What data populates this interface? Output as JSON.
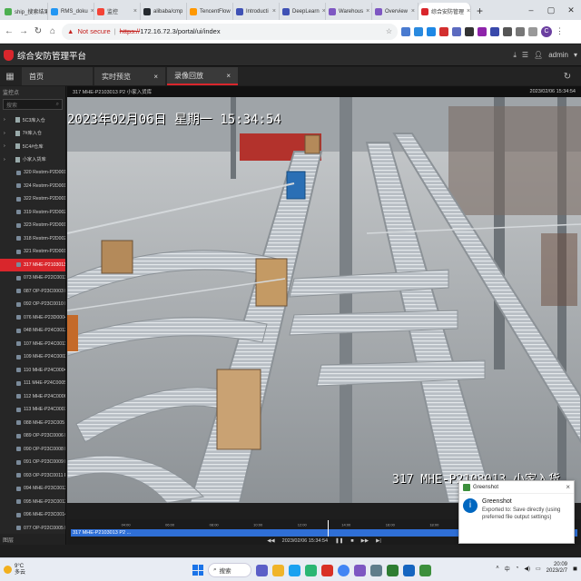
{
  "browser": {
    "tabs": [
      {
        "label": "ship_搜索结果",
        "color": "#4caf50"
      },
      {
        "label": "RMS_doku",
        "color": "#2196f3"
      },
      {
        "label": "监控",
        "color": "#f44336"
      },
      {
        "label": "alibaba/cmp",
        "color": "#24292e"
      },
      {
        "label": "TencentFlow",
        "color": "#ff9800"
      },
      {
        "label": "Introducti",
        "color": "#3f51b5"
      },
      {
        "label": "DeepLearn",
        "color": "#3f51b5"
      },
      {
        "label": "Warehous",
        "color": "#7e57c2"
      },
      {
        "label": "Overview",
        "color": "#7e57c2"
      },
      {
        "label": "综合安防管理",
        "color": "#d9262c"
      }
    ],
    "new_tab": "+",
    "security_warning": "Not secure",
    "url_scheme": "https://",
    "url": "172.16.72.3/portal/ui/index",
    "profile_initial": "C"
  },
  "app": {
    "title": "综合安防管理平台",
    "user": "admin",
    "tabs": [
      {
        "label": "首页"
      },
      {
        "label": "实时预览"
      },
      {
        "label": "录像回放"
      }
    ]
  },
  "left_panel": {
    "header": "监控点",
    "search_placeholder": "搜索",
    "groups": [
      {
        "label": "5C3库入仓"
      },
      {
        "label": "7#库入仓"
      },
      {
        "label": "5C4#仓库"
      },
      {
        "label": "小家入货库"
      }
    ],
    "cameras": [
      {
        "label": "320 Restrm-P2D0014"
      },
      {
        "label": "324 Restrm-P2D0016"
      },
      {
        "label": "322 Restrm-P2D0016"
      },
      {
        "label": "319 Restrm-P2D0026"
      },
      {
        "label": "323 Restrm-P2D0017"
      },
      {
        "label": "318 Restrm-P2D0025"
      },
      {
        "label": "321 Restrm-P2D0016"
      },
      {
        "label": "317 MHE-P2103013"
      },
      {
        "label": "073 MHE-P22C0011 P2"
      },
      {
        "label": "087 OP-P23C0003 P3"
      },
      {
        "label": "092 OP-P23C0010 P3"
      },
      {
        "label": "076 MHE-P23D0004 P"
      },
      {
        "label": "048 MHE-P24C0013 P"
      },
      {
        "label": "107 MHE-P24C0011 P"
      },
      {
        "label": "109 MHE-P24C0002 P"
      },
      {
        "label": "110 MHE-P24C0004 P"
      },
      {
        "label": "111 MHE-P24C0005 P"
      },
      {
        "label": "112 MHE-P24C0006 P"
      },
      {
        "label": "113 MHE-P24C0007 P"
      },
      {
        "label": "088 MHE-P23C005"
      },
      {
        "label": "089 OP-P23C0006 P3"
      },
      {
        "label": "090 OP-P23C0008 P3"
      },
      {
        "label": "091 OP-P23C0009 P3"
      },
      {
        "label": "093 OP-P23C0011 P3"
      },
      {
        "label": "094 MHE-P23C0012 P"
      },
      {
        "label": "095 MHE-P23C0013 P"
      },
      {
        "label": "096 MHE-P23C0014 P"
      },
      {
        "label": "077 OP-P22C0005 P3"
      }
    ],
    "selected_index": 7,
    "footer": "图层"
  },
  "video": {
    "title": "317 MHE-P2103013 P2 小家入货库",
    "timestamp": "2023/02/06 15:34:54",
    "osd_datetime": "2023年02月06日 星期一 15:34:54",
    "osd_camera": "317 MHE-P2103013 小家入货"
  },
  "timeline": {
    "ticks": [
      "04:00",
      "06:00",
      "08:00",
      "10:00",
      "12:00",
      "14:00",
      "16:00",
      "18:00",
      "20:00",
      "22:00"
    ],
    "channel_label": "317 MHE-P2103013 P2 ...",
    "current_time": "2023/02/06 15:34:54"
  },
  "toast": {
    "app": "Greenshot",
    "title": "Greenshot",
    "message": "Exported to: Save directly (using preferred file output settings)"
  },
  "taskbar": {
    "weather_temp": "9°C",
    "weather_desc": "多云",
    "search_label": "搜索",
    "ime": "中",
    "time": "20:09",
    "date": "2023/2/7"
  }
}
